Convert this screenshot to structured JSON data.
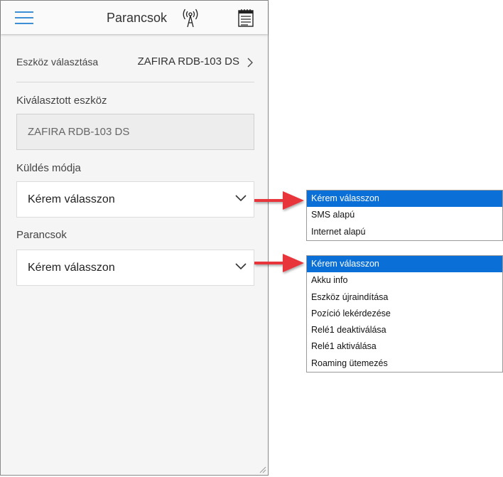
{
  "header": {
    "title": "Parancsok"
  },
  "device_row": {
    "label": "Eszköz választása",
    "value": "ZAFIRA RDB-103 DS"
  },
  "selected_device": {
    "label": "Kiválasztott eszköz",
    "value": "ZAFIRA RDB-103 DS"
  },
  "send_mode": {
    "label": "Küldés módja",
    "value": "Kérem válasszon",
    "options": [
      "Kérem válasszon",
      "SMS alapú",
      "Internet alapú"
    ],
    "selected_index": 0
  },
  "commands": {
    "label": "Parancsok",
    "value": "Kérem válasszon",
    "options": [
      "Kérem válasszon",
      "Akku info",
      "Eszköz újraindítása",
      "Pozíció lekérdezése",
      "Relé1 deaktiválása",
      "Relé1 aktiválása",
      "Roaming ütemezés"
    ],
    "selected_index": 0
  },
  "colors": {
    "accent": "#3d8fd6",
    "selection": "#0a6fd6",
    "arrow": "#e8343a"
  }
}
